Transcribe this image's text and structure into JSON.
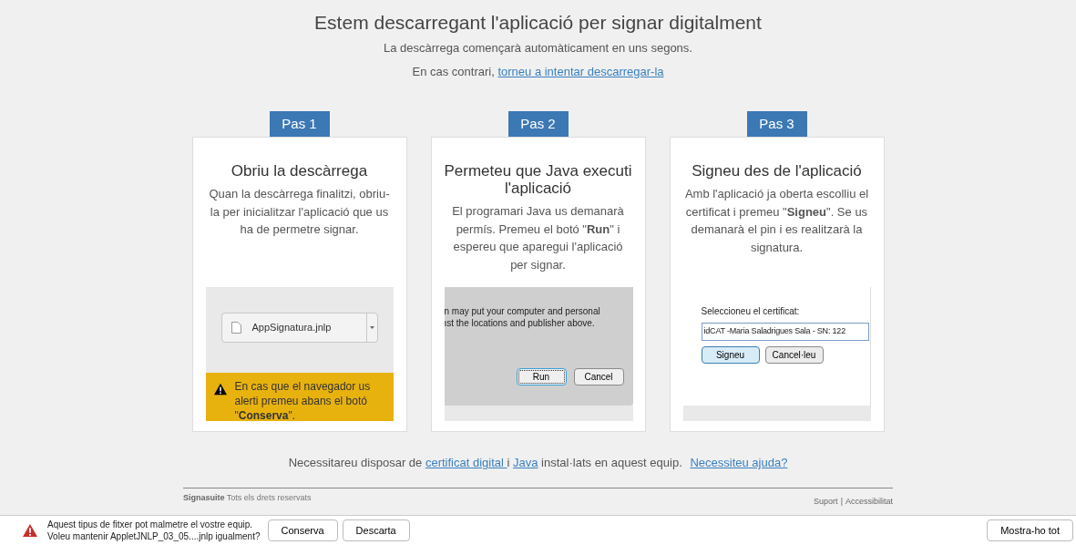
{
  "header": {
    "title": "Estem descarregant l'aplicació per signar digitalment",
    "line1": "La descàrrega començarà automàticament en uns segons.",
    "line2_prefix": "En cas contrari, ",
    "line2_link": "torneu a intentar descarregar-la"
  },
  "steps": [
    {
      "tab": "Pas 1",
      "title": "Obriu la descàrrega",
      "text": "Quan la descàrrega finalitzi, obriu-la per inicialitzar l'aplicació que us ha de permetre signar.",
      "illustration": {
        "kind": "download",
        "file": "AppSignatura.jnlp",
        "warning": "En cas que el navegador us alerti premeu abans el botó \"**Conserva**\"."
      }
    },
    {
      "tab": "Pas 2",
      "title": "Permeteu que Java executi l'aplicació",
      "text": "El programari Java us demanarà permís. Premeu el botó \"**Run**\" i espereu que aparegui l'aplicació per signar.",
      "illustration": {
        "kind": "java_dialog",
        "lines": [
          "n may put your computer and personal",
          "ıst the locations and publisher above."
        ],
        "buttons": [
          {
            "label": "Run",
            "focused": true
          },
          {
            "label": "Cancel",
            "focused": false
          }
        ]
      }
    },
    {
      "tab": "Pas 3",
      "title": "Signeu des de l'aplicació",
      "text": "Amb l'aplicació ja oberta escolliu el certificat i premeu \"**Signeu**\". Se us demanarà el pin i es realitzarà la signatura.",
      "illustration": {
        "kind": "cert_dialog",
        "label": "Seleccioneu el certificat:",
        "value": "idCAT -Maria Saladrigues Sala - SN: 122",
        "buttons": [
          {
            "label": "Signeu",
            "focused": true
          },
          {
            "label": "Cancel·leu",
            "focused": false
          }
        ]
      }
    }
  ],
  "requirements": {
    "prefix": "Necessitareu disposar de ",
    "link1": "certificat digital ",
    "middle": " i ",
    "link2": "Java",
    "suffix": " instal·lats en aquest equip.",
    "help": "Necessiteu ajuda?"
  },
  "footer": {
    "brand": "Signasuite",
    "rights": "Tots els drets reservats",
    "links": [
      "Suport",
      "Accessibilitat"
    ],
    "separator": "|"
  },
  "download_bar": {
    "message": [
      "Aquest tipus de fitxer pot malmetre el vostre equip.",
      "Voleu mantenir AppletJNLP_03_05....jnlp igualment?"
    ],
    "buttons": [
      "Conserva",
      "Descarta"
    ],
    "show_all": "Mostra-ho tot"
  }
}
